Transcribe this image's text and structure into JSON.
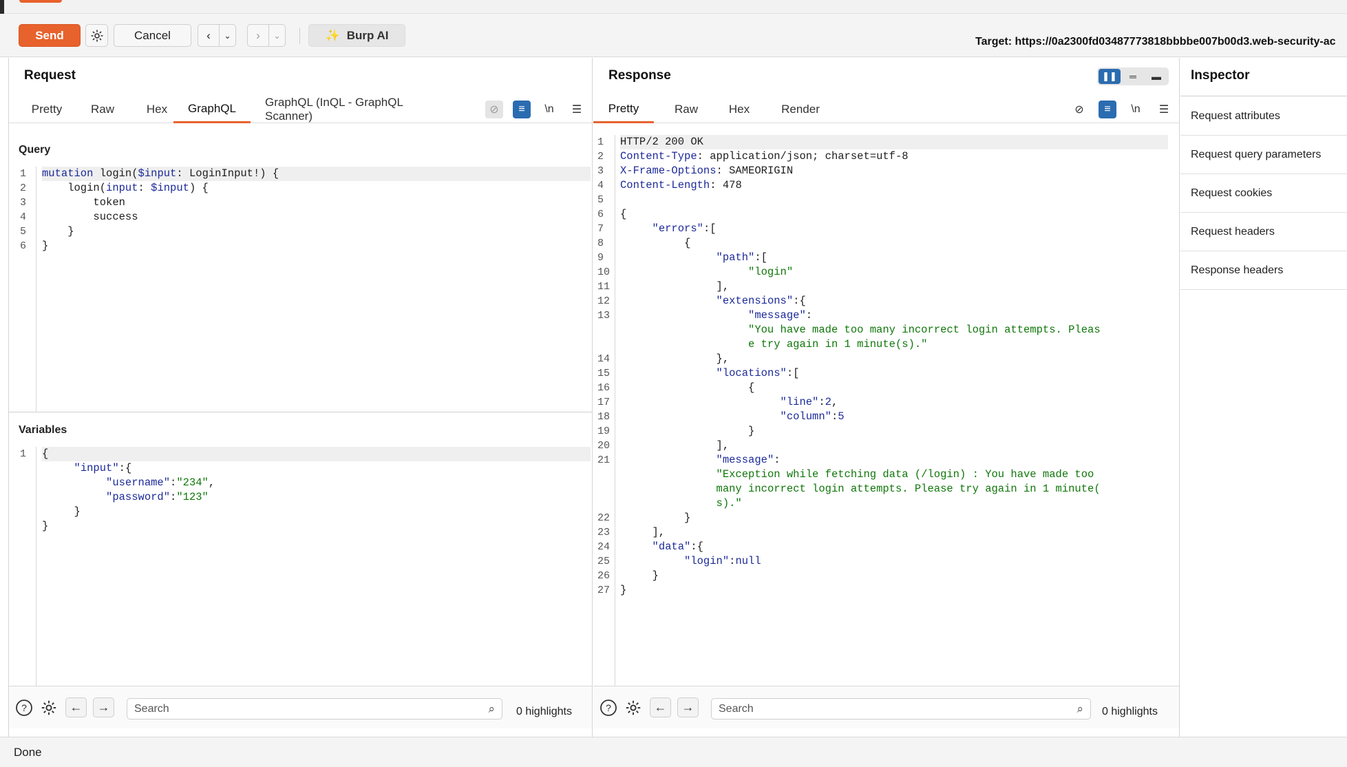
{
  "toolbar": {
    "send_label": "Send",
    "cancel_label": "Cancel",
    "burp_ai_label": "Burp AI",
    "target": "Target: https://0a2300fd03487773818bbbbe007b00d3.web-security-ac"
  },
  "request": {
    "title": "Request",
    "tabs": [
      "Pretty",
      "Raw",
      "Hex",
      "GraphQL",
      "GraphQL (InQL - GraphQL Scanner)"
    ],
    "active_tab": "GraphQL",
    "newline_toggle": "\\n",
    "query_label": "Query",
    "variables_label": "Variables",
    "search_placeholder": "Search",
    "highlights": "0 highlights"
  },
  "response": {
    "title": "Response",
    "tabs": [
      "Pretty",
      "Raw",
      "Hex",
      "Render"
    ],
    "active_tab": "Pretty",
    "newline_toggle": "\\n",
    "search_placeholder": "Search",
    "highlights": "0 highlights"
  },
  "inspector": {
    "title": "Inspector",
    "items": [
      "Request attributes",
      "Request query parameters",
      "Request cookies",
      "Request headers",
      "Response headers"
    ]
  },
  "status": "Done",
  "icons": {
    "settings": "gear-icon",
    "back": "chevron-left-icon",
    "forward": "chevron-right-icon",
    "dropdown": "chevron-down-icon",
    "burp_ai": "sparkle-icon",
    "hide": "eye-off-icon",
    "wrap": "wrap-icon",
    "menu": "hamburger-icon",
    "help": "help-icon",
    "search": "magnifier-icon"
  },
  "colors": {
    "accent": "#e8622d",
    "blue": "#2b6cb0"
  }
}
